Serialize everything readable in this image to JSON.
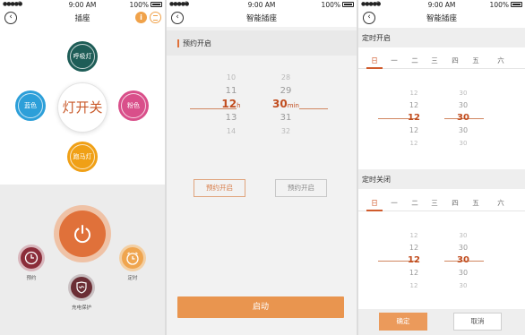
{
  "status": {
    "time": "9:00 AM",
    "battery": "100%"
  },
  "screen1": {
    "title": "插座",
    "info_label": "i",
    "center_label": "灯开关",
    "colors": {
      "top": {
        "label": "呼吸灯",
        "color": "#1e5d57"
      },
      "left": {
        "label": "蓝色",
        "color": "#2c9fd9"
      },
      "right": {
        "label": "粉色",
        "color": "#d94f8a"
      },
      "bottom": {
        "label": "跑马灯",
        "color": "#f0a016"
      }
    },
    "buttons": {
      "schedule": {
        "label": "预约"
      },
      "charge": {
        "label": "充电保护"
      },
      "timer": {
        "label": "定时"
      }
    }
  },
  "screen2": {
    "title": "智能插座",
    "section_label": "预约开启",
    "hours": [
      "10",
      "11",
      "12",
      "13",
      "14"
    ],
    "minutes": [
      "28",
      "29",
      "30",
      "31",
      "32"
    ],
    "hour_unit": "h",
    "minute_unit": "min",
    "btn_left": "预约开启",
    "btn_right": "预约开启",
    "start_label": "启动"
  },
  "screen3": {
    "title": "智能插座",
    "on_label": "定时开启",
    "off_label": "定时关闭",
    "weekdays": [
      "日",
      "一",
      "二",
      "三",
      "四",
      "五",
      "六"
    ],
    "hours": [
      "12",
      "12",
      "12",
      "12",
      "12"
    ],
    "minutes": [
      "30",
      "30",
      "30",
      "30",
      "30"
    ],
    "ok_label": "确定",
    "cancel_label": "取消"
  }
}
